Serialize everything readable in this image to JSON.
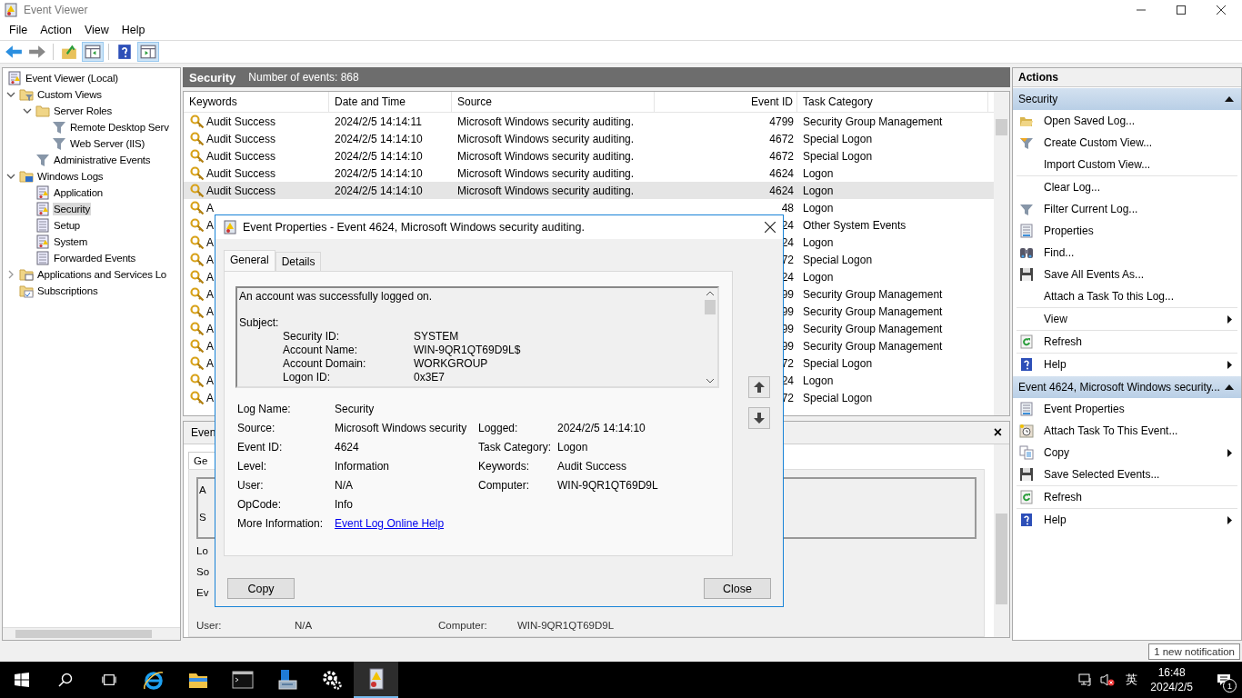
{
  "window": {
    "title": "Event Viewer"
  },
  "menu": [
    "File",
    "Action",
    "View",
    "Help"
  ],
  "tree": [
    {
      "label": "Event Viewer (Local)",
      "kind": "log",
      "selected": false,
      "children": [
        {
          "label": "Custom Views",
          "kind": "folder-filter",
          "expanded": true,
          "selected": false,
          "children": [
            {
              "label": "Server Roles",
              "kind": "folder",
              "expanded": true,
              "selected": false,
              "children": [
                {
                  "label": "Remote Desktop Serv",
                  "kind": "filter",
                  "selected": false
                },
                {
                  "label": "Web Server (IIS)",
                  "kind": "filter",
                  "selected": false
                }
              ]
            },
            {
              "label": "Administrative Events",
              "kind": "filter",
              "selected": false
            }
          ]
        },
        {
          "label": "Windows Logs",
          "kind": "folder-logs",
          "expanded": true,
          "selected": false,
          "children": [
            {
              "label": "Application",
              "kind": "log",
              "selected": false
            },
            {
              "label": "Security",
              "kind": "log",
              "selected": true
            },
            {
              "label": "Setup",
              "kind": "page",
              "selected": false
            },
            {
              "label": "System",
              "kind": "log",
              "selected": false
            },
            {
              "label": "Forwarded Events",
              "kind": "page",
              "selected": false
            }
          ]
        },
        {
          "label": "Applications and Services Lo",
          "kind": "folder-page",
          "expanded": false,
          "selected": false
        },
        {
          "label": "Subscriptions",
          "kind": "folder-sub",
          "selected": false
        }
      ]
    }
  ],
  "log_header": {
    "title": "Security",
    "count": "Number of events: 868"
  },
  "table": {
    "columns": [
      "Keywords",
      "Date and Time",
      "Source",
      "Event ID",
      "Task Category"
    ],
    "rows": [
      {
        "keyword": "Audit Success",
        "date": "2024/2/5 14:14:11",
        "source": "Microsoft Windows security auditing.",
        "event_id": "4799",
        "category": "Security Group Management",
        "selected": false
      },
      {
        "keyword": "Audit Success",
        "date": "2024/2/5 14:14:10",
        "source": "Microsoft Windows security auditing.",
        "event_id": "4672",
        "category": "Special Logon",
        "selected": false
      },
      {
        "keyword": "Audit Success",
        "date": "2024/2/5 14:14:10",
        "source": "Microsoft Windows security auditing.",
        "event_id": "4672",
        "category": "Special Logon",
        "selected": false
      },
      {
        "keyword": "Audit Success",
        "date": "2024/2/5 14:14:10",
        "source": "Microsoft Windows security auditing.",
        "event_id": "4624",
        "category": "Logon",
        "selected": false
      },
      {
        "keyword": "Audit Success",
        "date": "2024/2/5 14:14:10",
        "source": "Microsoft Windows security auditing.",
        "event_id": "4624",
        "category": "Logon",
        "selected": true
      },
      {
        "keyword": "A",
        "event_id": "48",
        "category": "Logon",
        "selected": false
      },
      {
        "keyword": "A",
        "event_id": "24",
        "category": "Other System Events",
        "selected": false
      },
      {
        "keyword": "A",
        "event_id": "24",
        "category": "Logon",
        "selected": false
      },
      {
        "keyword": "A",
        "event_id": "72",
        "category": "Special Logon",
        "selected": false
      },
      {
        "keyword": "A",
        "event_id": "24",
        "category": "Logon",
        "selected": false
      },
      {
        "keyword": "A",
        "event_id": "99",
        "category": "Security Group Management",
        "selected": false
      },
      {
        "keyword": "A",
        "event_id": "99",
        "category": "Security Group Management",
        "selected": false
      },
      {
        "keyword": "A",
        "event_id": "99",
        "category": "Security Group Management",
        "selected": false
      },
      {
        "keyword": "A",
        "event_id": "99",
        "category": "Security Group Management",
        "selected": false
      },
      {
        "keyword": "A",
        "event_id": "72",
        "category": "Special Logon",
        "selected": false
      },
      {
        "keyword": "A",
        "event_id": "24",
        "category": "Logon",
        "selected": false
      },
      {
        "keyword": "A",
        "event_id": "72",
        "category": "Special Logon",
        "selected": false
      }
    ]
  },
  "preview": {
    "tab": "Even",
    "close": "×",
    "subtab": "Ge",
    "box_lines": [
      "A",
      "S"
    ],
    "labels": [
      "Lo",
      "So",
      "Ev"
    ],
    "last_row": {
      "label": "User:",
      "value": "N/A",
      "label2": "Computer:",
      "value2": "WIN-9QR1QT69D9L"
    }
  },
  "actions": {
    "title": "Actions",
    "sections": [
      {
        "title": "Security",
        "expanded": true,
        "items": [
          {
            "label": "Open Saved Log...",
            "kind": "open-folder"
          },
          {
            "label": "Create Custom View...",
            "kind": "funnel-star"
          },
          {
            "label": "Import Custom View...",
            "kind": "none",
            "rule_after": true
          },
          {
            "label": "Clear Log...",
            "kind": "none"
          },
          {
            "label": "Filter Current Log...",
            "kind": "funnel"
          },
          {
            "label": "Properties",
            "kind": "properties"
          },
          {
            "label": "Find...",
            "kind": "binoculars"
          },
          {
            "label": "Save All Events As...",
            "kind": "floppy"
          },
          {
            "label": "Attach a Task To this Log...",
            "kind": "none",
            "rule_after": true
          },
          {
            "label": "View",
            "kind": "none",
            "submenu": true,
            "rule_after": true
          },
          {
            "label": "Refresh",
            "kind": "refresh",
            "rule_after": true
          },
          {
            "label": "Help",
            "kind": "help",
            "submenu": true
          }
        ]
      },
      {
        "title": "Event 4624, Microsoft Windows security...",
        "expanded": true,
        "items": [
          {
            "label": "Event Properties",
            "kind": "properties"
          },
          {
            "label": "Attach Task To This Event...",
            "kind": "clock"
          },
          {
            "label": "Copy",
            "kind": "copy",
            "submenu": true
          },
          {
            "label": "Save Selected Events...",
            "kind": "floppy",
            "rule_after": true
          },
          {
            "label": "Refresh",
            "kind": "refresh",
            "rule_after": true
          },
          {
            "label": "Help",
            "kind": "help",
            "submenu": true
          }
        ]
      }
    ]
  },
  "dialog": {
    "title": "Event Properties - Event 4624, Microsoft Windows security auditing.",
    "tabs": [
      {
        "label": "General",
        "selected": true
      },
      {
        "label": "Details",
        "selected": false
      }
    ],
    "message": "An account was successfully logged on.",
    "section": "Subject:",
    "pairs": [
      {
        "label": "Security ID:",
        "value": "SYSTEM"
      },
      {
        "label": "Account Name:",
        "value": "WIN-9QR1QT69D9L$"
      },
      {
        "label": "Account Domain:",
        "value": "WORKGROUP"
      },
      {
        "label": "Logon ID:",
        "value": "0x3E7"
      }
    ],
    "fields": [
      {
        "label": "Log Name:",
        "value": "Security",
        "kind": "text"
      },
      {
        "label": "Source:",
        "value": "Microsoft Windows security",
        "label2": "Logged:",
        "value2": "2024/2/5 14:14:10",
        "kind": "text"
      },
      {
        "label": "Event ID:",
        "value": "4624",
        "label2": "Task Category:",
        "value2": "Logon",
        "kind": "text"
      },
      {
        "label": "Level:",
        "value": "Information",
        "label2": "Keywords:",
        "value2": "Audit Success",
        "kind": "text"
      },
      {
        "label": "User:",
        "value": "N/A",
        "label2": "Computer:",
        "value2": "WIN-9QR1QT69D9L",
        "kind": "text"
      },
      {
        "label": "OpCode:",
        "value": "Info",
        "kind": "text"
      },
      {
        "label": "More Information:",
        "value": "Event Log Online Help",
        "kind": "link"
      }
    ],
    "buttons": [
      "Copy",
      "Close"
    ]
  },
  "notification": "1 new notification",
  "taskbar": {
    "apps": [
      {
        "kind": "ie",
        "selected": false
      },
      {
        "kind": "explorer",
        "selected": false
      },
      {
        "kind": "cmd",
        "selected": false
      },
      {
        "kind": "server",
        "selected": false
      },
      {
        "kind": "gear",
        "selected": false
      },
      {
        "kind": "eventlog",
        "selected": true
      }
    ],
    "ime": "英",
    "time": "16:48",
    "date": "2024/2/5",
    "badge": "1"
  }
}
